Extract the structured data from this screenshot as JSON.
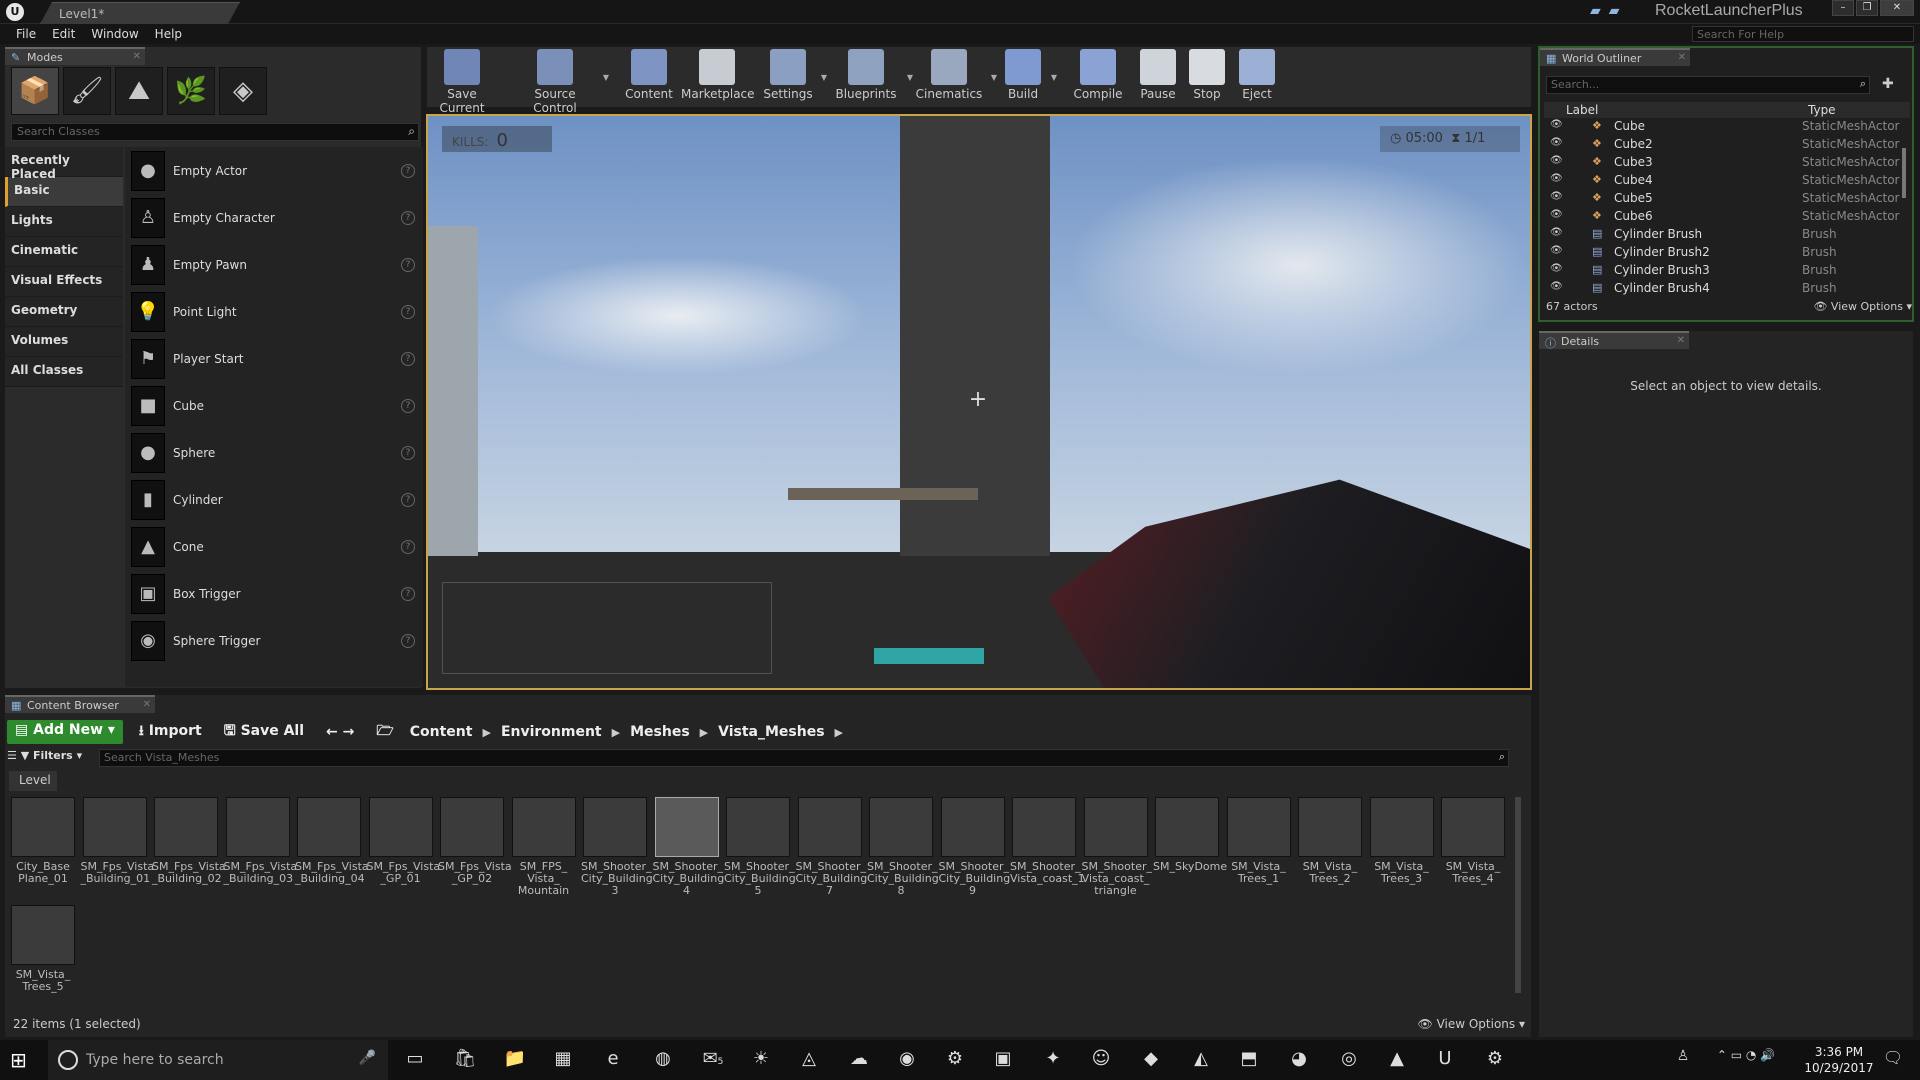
{
  "window": {
    "level_tab": "Level1*",
    "project": "RocketLauncherPlus",
    "help_placeholder": "Search For Help"
  },
  "menu": [
    "File",
    "Edit",
    "Window",
    "Help"
  ],
  "modes": {
    "tab": "Modes",
    "search_placeholder": "Search Classes",
    "categories": [
      "Recently Placed",
      "Basic",
      "Lights",
      "Cinematic",
      "Visual Effects",
      "Geometry",
      "Volumes",
      "All Classes"
    ],
    "actors": [
      "Empty Actor",
      "Empty Character",
      "Empty Pawn",
      "Point Light",
      "Player Start",
      "Cube",
      "Sphere",
      "Cylinder",
      "Cone",
      "Box Trigger",
      "Sphere Trigger"
    ]
  },
  "toolbar": [
    "Save Current",
    "Source Control",
    "Content",
    "Marketplace",
    "Settings",
    "Blueprints",
    "Cinematics",
    "Build",
    "Compile",
    "Pause",
    "Stop",
    "Eject"
  ],
  "viewport": {
    "kills_label": "KILLS:",
    "kills_value": "0",
    "timer": "05:00",
    "round": "1/1"
  },
  "outliner": {
    "tab": "World Outliner",
    "search_placeholder": "Search...",
    "col_label": "Label",
    "col_type": "Type",
    "rows": [
      {
        "name": "Cube",
        "type": "StaticMeshActor"
      },
      {
        "name": "Cube2",
        "type": "StaticMeshActor"
      },
      {
        "name": "Cube3",
        "type": "StaticMeshActor"
      },
      {
        "name": "Cube4",
        "type": "StaticMeshActor"
      },
      {
        "name": "Cube5",
        "type": "StaticMeshActor"
      },
      {
        "name": "Cube6",
        "type": "StaticMeshActor"
      },
      {
        "name": "Cylinder Brush",
        "type": "Brush"
      },
      {
        "name": "Cylinder Brush2",
        "type": "Brush"
      },
      {
        "name": "Cylinder Brush3",
        "type": "Brush"
      },
      {
        "name": "Cylinder Brush4",
        "type": "Brush"
      }
    ],
    "count": "67 actors",
    "view_options": "View Options"
  },
  "details": {
    "tab": "Details",
    "message": "Select an object to view details."
  },
  "content_browser": {
    "tab": "Content Browser",
    "add_new": "Add New",
    "import": "Import",
    "save_all": "Save All",
    "breadcrumb": [
      "Content",
      "Environment",
      "Meshes",
      "Vista_Meshes"
    ],
    "filters": "Filters",
    "search_placeholder": "Search Vista_Meshes",
    "level_tag": "Level",
    "assets": [
      "City_Base Plane_01",
      "SM_Fps_Vista _Building_01",
      "SM_Fps_Vista _Building_02",
      "SM_Fps_Vista _Building_03",
      "SM_Fps_Vista _Building_04",
      "SM_Fps_Vista _GP_01",
      "SM_Fps_Vista _GP_02",
      "SM_FPS_ Vista_ Mountain",
      "SM_Shooter_ City_Building 3",
      "SM_Shooter_ City_Building 4",
      "SM_Shooter_ City_Building 5",
      "SM_Shooter_ City_Building 7",
      "SM_Shooter_ City_Building 8",
      "SM_Shooter_ City_Building 9",
      "SM_Shooter_ Vista_coast_1",
      "SM_Shooter_ Vista_coast_ triangle",
      "SM_SkyDome",
      "SM_Vista_ Trees_1",
      "SM_Vista_ Trees_2",
      "SM_Vista_ Trees_3",
      "SM_Vista_ Trees_4",
      "SM_Vista_ Trees_5"
    ],
    "selected_index": 9,
    "count": "22 items (1 selected)",
    "view_options": "View Options"
  },
  "taskbar": {
    "search_placeholder": "Type here to search",
    "time": "3:36 PM",
    "date": "10/29/2017",
    "badge": "5"
  },
  "colors": {
    "add_new": "#2d8a2d",
    "viewport_border": "#c9a44a",
    "outliner_border": "#2f5f2f"
  }
}
